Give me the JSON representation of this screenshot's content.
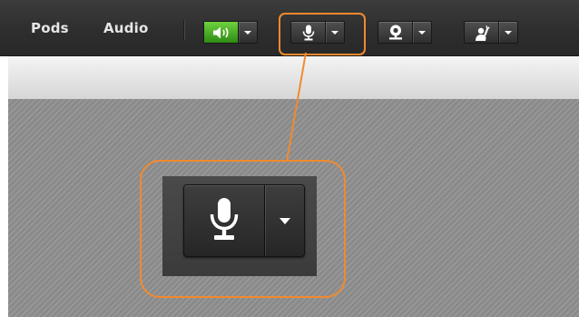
{
  "menubar": {
    "items": [
      {
        "label": "Pods"
      },
      {
        "label": "Audio"
      }
    ]
  },
  "toolbar": {
    "buttons": [
      {
        "icon": "speaker-icon",
        "state": "on",
        "active_color": "#4cb52a"
      },
      {
        "icon": "microphone-icon"
      },
      {
        "icon": "webcam-icon"
      },
      {
        "icon": "raise-hand-icon"
      }
    ]
  },
  "callout": {
    "highlight_color": "#f28a2e",
    "zoomed_button": {
      "icon": "microphone-icon"
    }
  }
}
